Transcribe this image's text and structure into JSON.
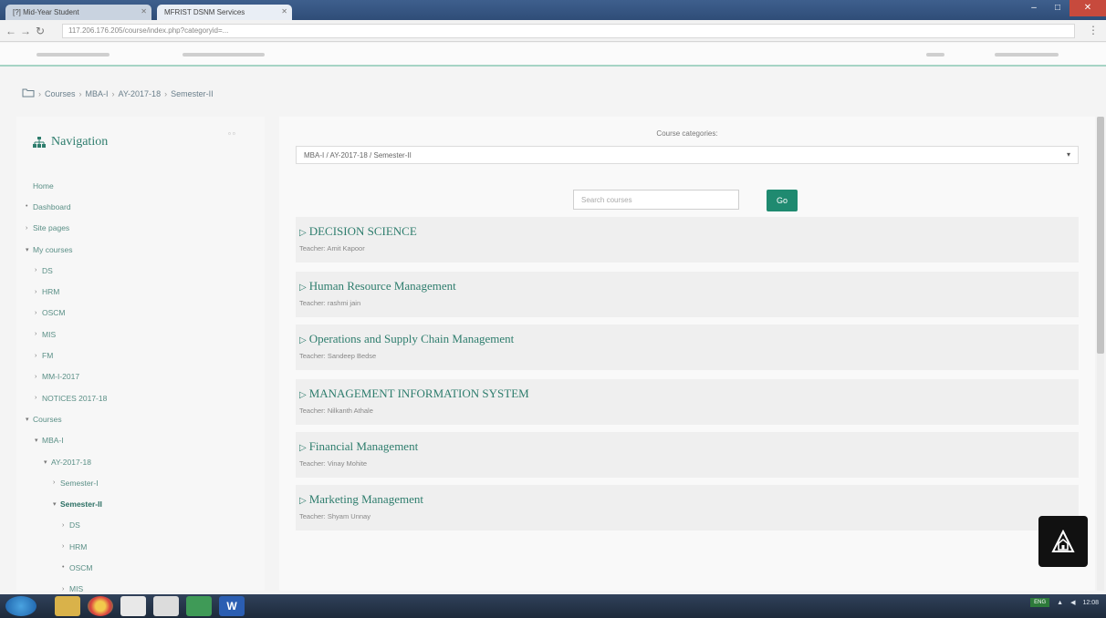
{
  "browser": {
    "tabs": [
      {
        "label": "[?] Mid-Year Student"
      },
      {
        "label": "MFRIST DSNM Services"
      }
    ],
    "url": "117.206.176.205/course/index.php?categoryid=..."
  },
  "breadcrumb": [
    "Courses",
    "MBA-I",
    "AY-2017-18",
    "Semester-II"
  ],
  "nav": {
    "title": "Navigation",
    "items": [
      {
        "label": "Home",
        "arrow": "",
        "level": 0,
        "bold": false
      },
      {
        "label": "Dashboard",
        "arrow": "•",
        "level": 0,
        "bold": false
      },
      {
        "label": "Site pages",
        "arrow": "›",
        "level": 0,
        "bold": false
      },
      {
        "label": "My courses",
        "arrow": "▾",
        "level": 0,
        "bold": false
      },
      {
        "label": "DS",
        "arrow": "›",
        "level": 1,
        "bold": false
      },
      {
        "label": "HRM",
        "arrow": "›",
        "level": 1,
        "bold": false
      },
      {
        "label": "OSCM",
        "arrow": "›",
        "level": 1,
        "bold": false
      },
      {
        "label": "MIS",
        "arrow": "›",
        "level": 1,
        "bold": false
      },
      {
        "label": "FM",
        "arrow": "›",
        "level": 1,
        "bold": false
      },
      {
        "label": "MM-I-2017",
        "arrow": "›",
        "level": 1,
        "bold": false
      },
      {
        "label": "NOTICES 2017-18",
        "arrow": "›",
        "level": 1,
        "bold": false
      },
      {
        "label": "Courses",
        "arrow": "▾",
        "level": 0,
        "bold": false
      },
      {
        "label": "MBA-I",
        "arrow": "▾",
        "level": 1,
        "bold": false
      },
      {
        "label": "AY-2017-18",
        "arrow": "▾",
        "level": 2,
        "bold": false
      },
      {
        "label": "Semester-I",
        "arrow": "›",
        "level": 3,
        "bold": false
      },
      {
        "label": "Semester-II",
        "arrow": "▾",
        "level": 3,
        "bold": true
      },
      {
        "label": "DS",
        "arrow": "›",
        "level": 4,
        "bold": false
      },
      {
        "label": "HRM",
        "arrow": "›",
        "level": 4,
        "bold": false
      },
      {
        "label": "OSCM",
        "arrow": "•",
        "level": 4,
        "bold": false
      },
      {
        "label": "MIS",
        "arrow": "›",
        "level": 4,
        "bold": false
      }
    ]
  },
  "main": {
    "category_label": "Course categories:",
    "category_selected": "MBA-I / AY-2017-18 / Semester-II",
    "search_placeholder": "Search courses",
    "go_label": "Go",
    "courses": [
      {
        "name": "DECISION SCIENCE",
        "teacher": "Teacher: Amit Kapoor"
      },
      {
        "name": "Human Resource Management",
        "teacher": "Teacher: rashmi jain"
      },
      {
        "name": "Operations and Supply Chain Management",
        "teacher": "Teacher: Sandeep Bedse"
      },
      {
        "name": "MANAGEMENT INFORMATION SYSTEM",
        "teacher": "Teacher: Nilkanth Athale"
      },
      {
        "name": "Financial Management",
        "teacher": "Teacher: Vinay Mohite"
      },
      {
        "name": "Marketing Management",
        "teacher": "Teacher: Shyam Unnay"
      }
    ]
  },
  "taskbar": {
    "clock": "12:08",
    "tray_badge": "ENG"
  },
  "colors": {
    "accent": "#1f8a70",
    "link": "#2e7d6d"
  }
}
